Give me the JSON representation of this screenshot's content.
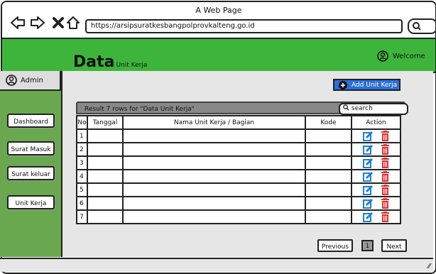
{
  "window": {
    "title": "A Web Page",
    "url": "https://arsipsuratkesbangpolprovkalteng.go.id"
  },
  "header": {
    "logo_big": "Data",
    "logo_small": "Unit Kerja",
    "welcome": "Welcome"
  },
  "sidebar": {
    "admin": "Admin",
    "items": [
      {
        "label": "Dashboard"
      },
      {
        "label": "Surat Masuk"
      },
      {
        "label": "Surat keluar"
      },
      {
        "label": "Unit Kerja"
      }
    ]
  },
  "main": {
    "add_button": "Add Unit Kerja",
    "result_text": "Result 7 rows for \"Data Unit Kerja\"",
    "search_placeholder": "search",
    "table": {
      "columns": [
        "No",
        "Tanggal",
        "Nama Unit Kerja / Bagian",
        "Kode",
        "Action"
      ],
      "rows": [
        "1",
        "2",
        "3",
        "4",
        "5",
        "6",
        "7"
      ]
    },
    "pager": {
      "previous": "Previous",
      "page": "1",
      "next": "Next"
    }
  },
  "colors": {
    "accent_green": "#3db53b",
    "sidebar_green": "#6aa84f",
    "button_blue": "#2a6edb",
    "edit_blue": "#1e7fd6",
    "delete_red": "#e03131"
  }
}
